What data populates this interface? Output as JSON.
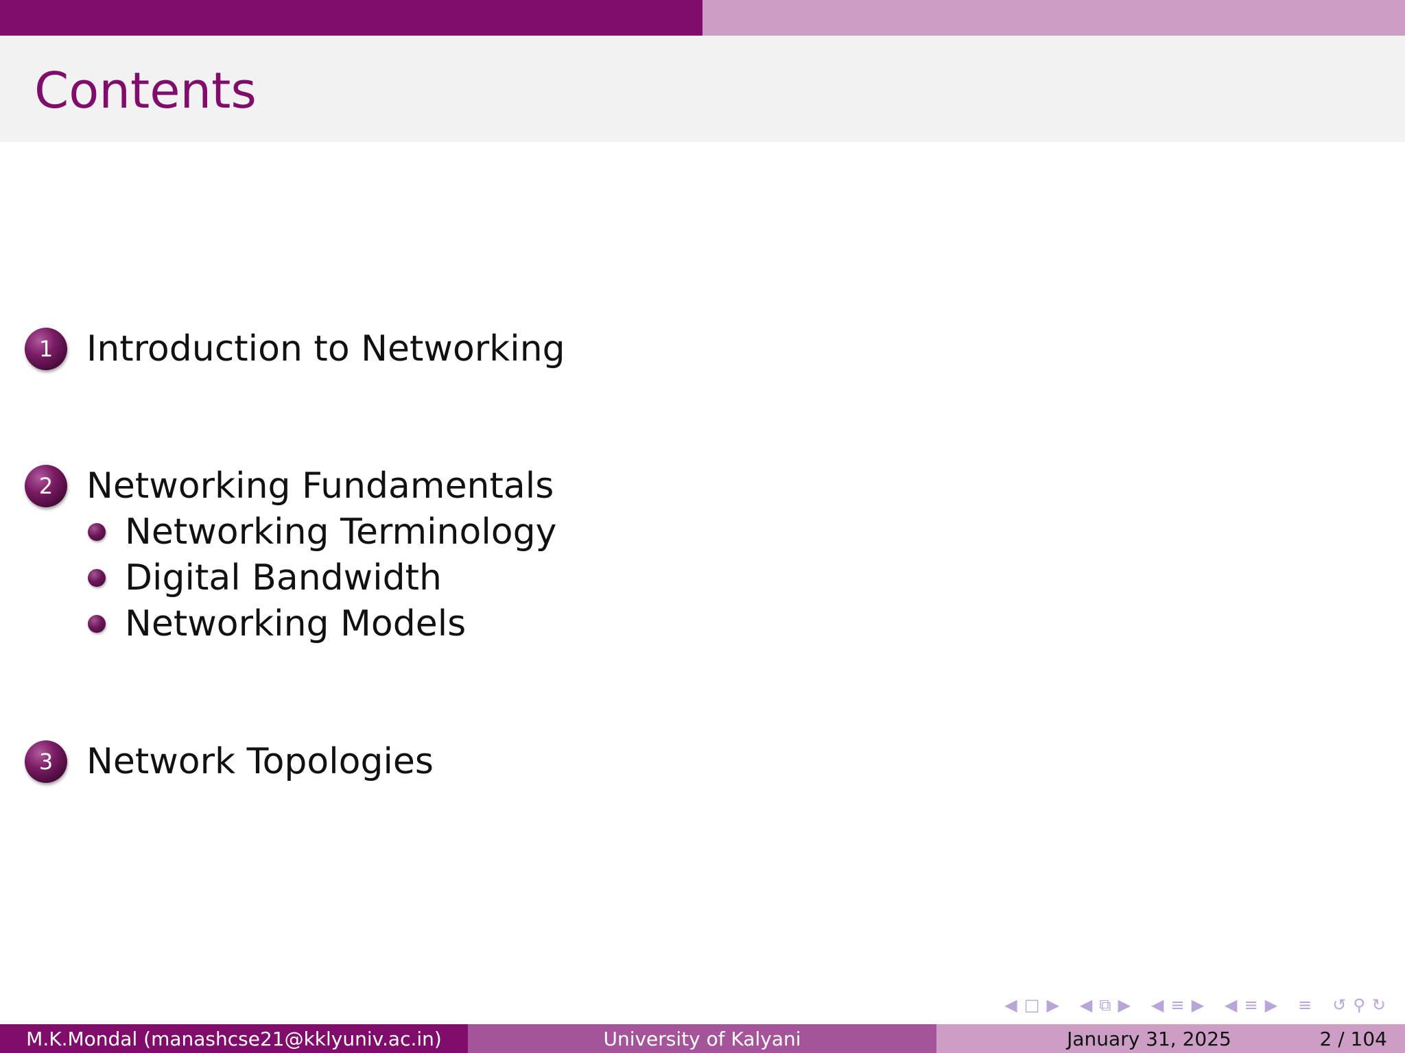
{
  "frame": {
    "title": "Contents"
  },
  "toc": {
    "sections": [
      {
        "number": "1",
        "label": "Introduction to Networking",
        "subsections": []
      },
      {
        "number": "2",
        "label": "Networking Fundamentals",
        "subsections": [
          "Networking Terminology",
          "Digital Bandwidth",
          "Networking Models"
        ]
      },
      {
        "number": "3",
        "label": "Network Topologies",
        "subsections": []
      }
    ]
  },
  "footer": {
    "author": "M.K.Mondal  (manashcse21@kklyuniv.ac.in)",
    "institute": "University of Kalyani",
    "date": "January 31, 2025",
    "page": "2 / 104"
  },
  "navigation": {
    "icons": [
      "nav-prev-icon",
      "frame-icon",
      "nav-next-icon",
      "nav-prev-icon",
      "subsection-icon",
      "nav-next-icon",
      "nav-prev-icon",
      "section-icon",
      "nav-next-icon",
      "nav-prev-icon",
      "document-icon",
      "nav-next-icon",
      "toc-icon",
      "back-icon",
      "search-icon",
      "forward-icon"
    ]
  },
  "colors": {
    "primary": "#800d6b",
    "secondary": "#a5549a",
    "tertiary": "#cc9ec5",
    "titlebar_bg": "#f2f2f2",
    "nav_symbols": "#b9a6d8"
  }
}
